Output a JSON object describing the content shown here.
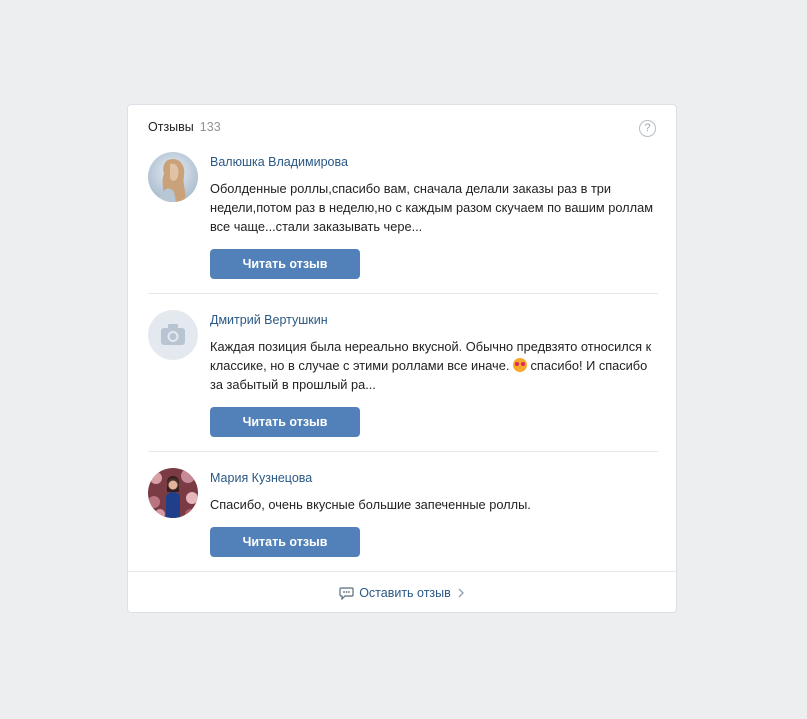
{
  "widget": {
    "title": "Отзывы",
    "count": "133",
    "help_icon": "question-circle-icon"
  },
  "reviews": [
    {
      "author": "Валюшка Владимирова",
      "text": "Оболденные роллы,спасибо вам, сначала делали заказы раз в три недели,потом раз в неделю,но с каждым разом скучаем по вашим роллам все чаще...стали заказывать чере...",
      "button": "Читать отзыв",
      "avatar": "photo"
    },
    {
      "author": "Дмитрий Вертушкин",
      "text_before": "Каждая позиция была нереально вкусной. Обычно предвзято относился к классике, но в случае с этими роллами все иначе.",
      "emoji": "heart-eyes-emoji",
      "text_after": "спасибо! И спасибо за забытый в прошлый ра...",
      "button": "Читать отзыв",
      "avatar": "camera-placeholder"
    },
    {
      "author": "Мария Кузнецова",
      "text": "Спасибо, очень вкусные большие запеченные роллы.",
      "button": "Читать отзыв",
      "avatar": "photo"
    }
  ],
  "footer": {
    "leave_review": "Оставить отзыв",
    "icon": "comment-icon",
    "chevron": "chevron-right-icon"
  },
  "colors": {
    "background": "#edeef0",
    "link": "#2a5885",
    "button": "#5181b8"
  }
}
